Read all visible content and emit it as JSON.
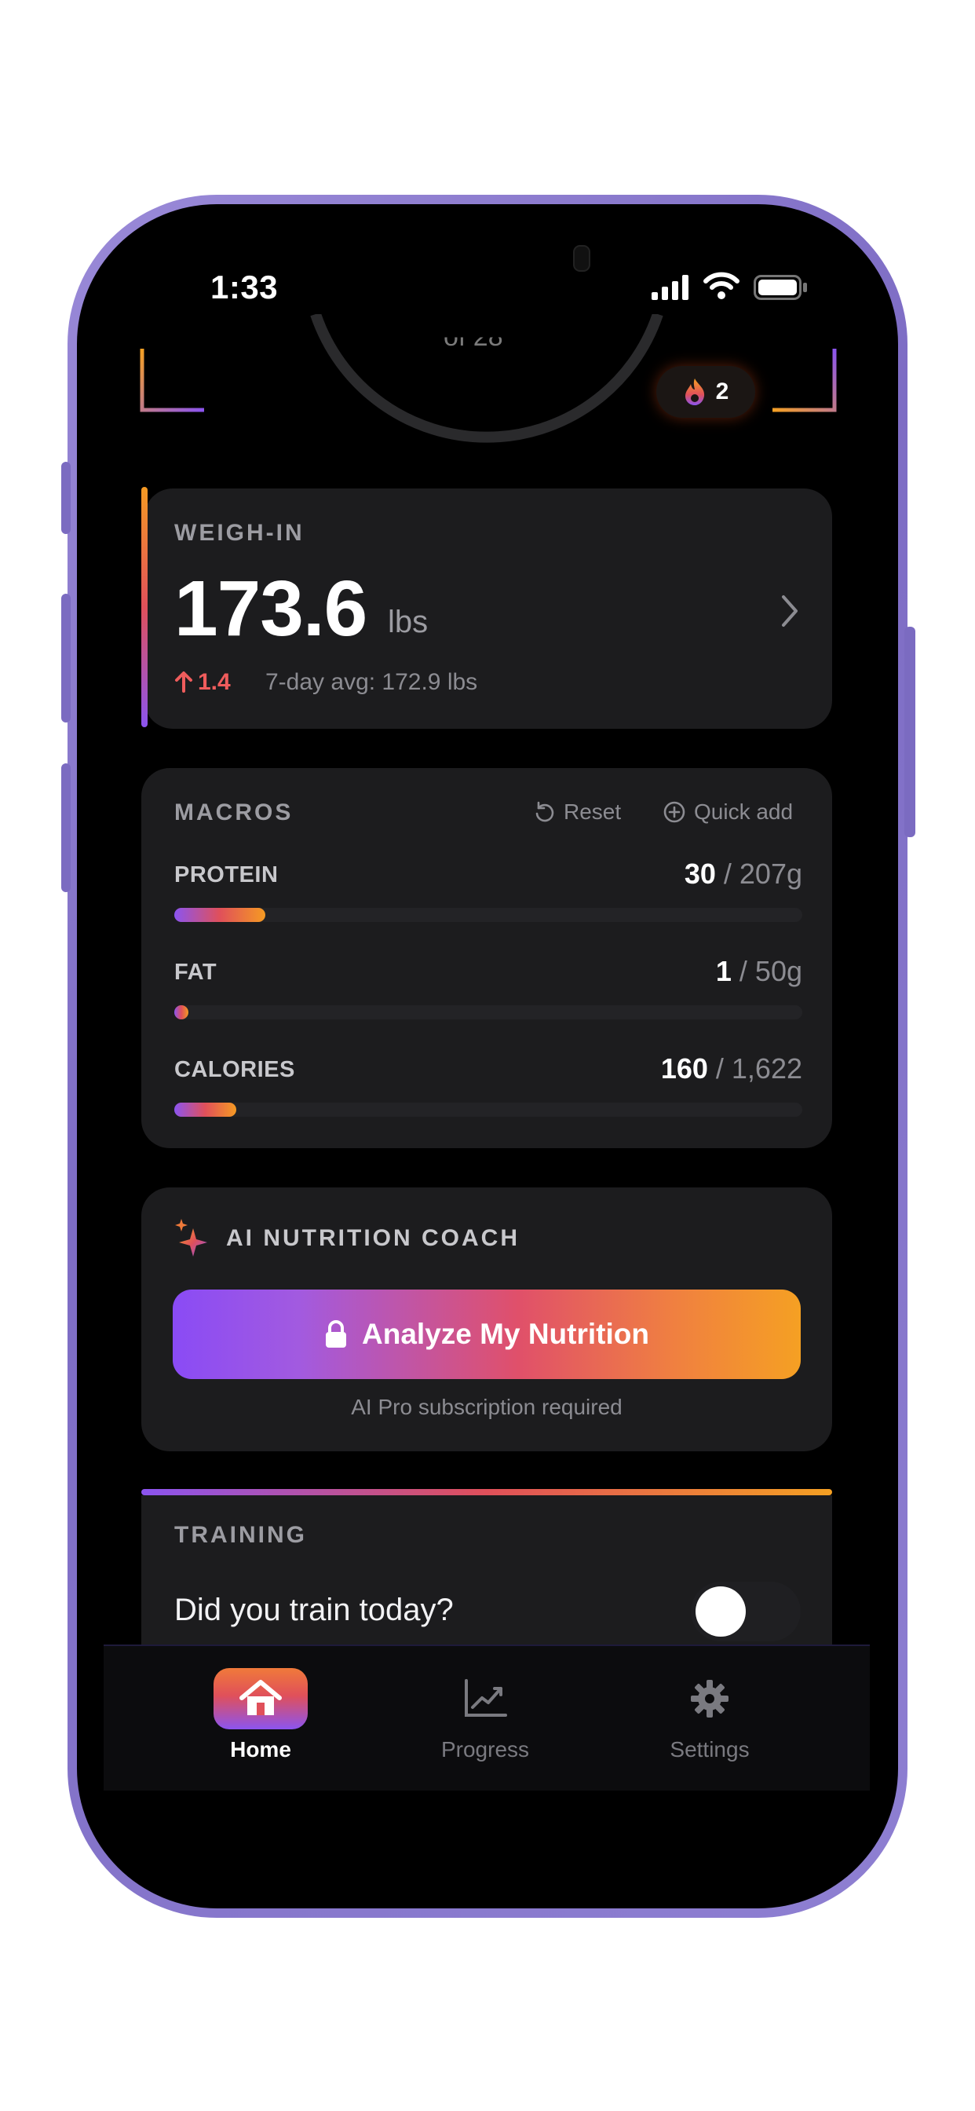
{
  "status_bar": {
    "time": "1:33"
  },
  "header": {
    "ring_text": "of 28",
    "streak_count": "2"
  },
  "weigh_in": {
    "title": "WEIGH-IN",
    "value": "173.6",
    "unit": "lbs",
    "delta": "1.4",
    "avg": "7-day avg: 172.9 lbs"
  },
  "macros": {
    "title": "MACROS",
    "reset_label": "Reset",
    "quick_add_label": "Quick add",
    "items": [
      {
        "label": "PROTEIN",
        "current": "30",
        "target": " / 207g",
        "fraction": 0.145
      },
      {
        "label": "FAT",
        "current": "1",
        "target": " / 50g",
        "fraction": 0.02
      },
      {
        "label": "CALORIES",
        "current": "160",
        "target": " / 1,622",
        "fraction": 0.099
      }
    ]
  },
  "coach": {
    "title": "AI NUTRITION COACH",
    "button_label": "Analyze My Nutrition",
    "note": "AI Pro subscription required"
  },
  "training": {
    "title": "TRAINING",
    "question": "Did you train today?",
    "toggle_on": false
  },
  "tabs": [
    {
      "label": "Home",
      "icon": "home-icon",
      "active": true
    },
    {
      "label": "Progress",
      "icon": "chart-icon",
      "active": false
    },
    {
      "label": "Settings",
      "icon": "gear-icon",
      "active": false
    }
  ],
  "colors": {
    "accent_purple": "#8b54f0",
    "accent_orange": "#f5a023",
    "accent_red": "#e0505a",
    "card_bg": "#1c1c1e",
    "delta_up": "#ef5c5c"
  }
}
